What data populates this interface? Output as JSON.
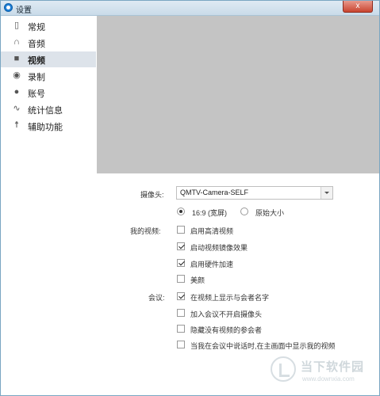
{
  "window": {
    "title": "设置",
    "close_label": "x"
  },
  "sidebar": {
    "items": [
      {
        "label": "常规",
        "icon": "phone-icon",
        "active": false
      },
      {
        "label": "音频",
        "icon": "headphones-icon",
        "active": false
      },
      {
        "label": "视频",
        "icon": "video-camera-icon",
        "active": true
      },
      {
        "label": "录制",
        "icon": "record-icon",
        "active": false
      },
      {
        "label": "账号",
        "icon": "user-icon",
        "active": false
      },
      {
        "label": "统计信息",
        "icon": "pulse-icon",
        "active": false
      },
      {
        "label": "辅助功能",
        "icon": "accessibility-icon",
        "active": false
      }
    ]
  },
  "camera": {
    "label": "摄像头:",
    "value": "QMTV-Camera-SELF",
    "ratio_options": [
      {
        "label": "16:9 (宽屏)",
        "selected": true
      },
      {
        "label": "原始大小",
        "selected": false
      }
    ]
  },
  "my_video": {
    "label": "我的视频:",
    "options": [
      {
        "label": "启用高清视频",
        "checked": false
      },
      {
        "label": "启动视频镜像效果",
        "checked": true
      },
      {
        "label": "启用硬件加速",
        "checked": true
      },
      {
        "label": "美颜",
        "checked": false
      }
    ]
  },
  "meeting": {
    "label": "会议:",
    "options": [
      {
        "label": "在视频上显示与会者名字",
        "checked": true
      },
      {
        "label": "加入会议不开启摄像头",
        "checked": false
      },
      {
        "label": "隐藏没有视频的参会者",
        "checked": false
      },
      {
        "label": "当我在会议中说话时,在主画面中显示我的视频",
        "checked": false
      }
    ]
  },
  "watermark": {
    "cn": "当下软件园",
    "en": "www.downxia.com"
  },
  "colors": {
    "active_nav_bg": "#dde3ea",
    "preview_bg": "#c4c4c4",
    "titlebar": "#c9dbe9"
  }
}
